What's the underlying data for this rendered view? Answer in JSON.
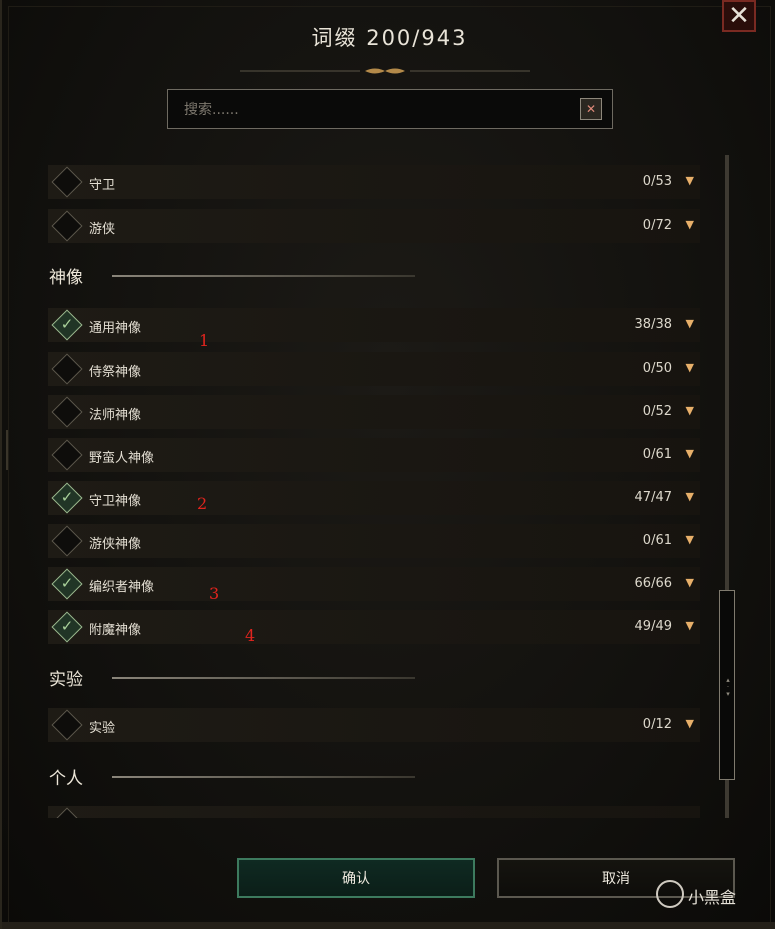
{
  "dialog": {
    "title": "词缀 200/943",
    "close_label": "✕"
  },
  "search": {
    "placeholder": "搜索......",
    "value": "",
    "clear_label": "✕"
  },
  "sections": {
    "idols_title": "神像",
    "experimental_title": "实验",
    "personal_title": "个人"
  },
  "rows": [
    {
      "label": "守卫",
      "count": "0/53",
      "checked": false
    },
    {
      "label": "游侠",
      "count": "0/72",
      "checked": false
    },
    {
      "label": "通用神像",
      "count": "38/38",
      "checked": true
    },
    {
      "label": "侍祭神像",
      "count": "0/50",
      "checked": false
    },
    {
      "label": "法师神像",
      "count": "0/52",
      "checked": false
    },
    {
      "label": "野蛮人神像",
      "count": "0/61",
      "checked": false
    },
    {
      "label": "守卫神像",
      "count": "47/47",
      "checked": true
    },
    {
      "label": "游侠神像",
      "count": "0/61",
      "checked": false
    },
    {
      "label": "编织者神像",
      "count": "66/66",
      "checked": true
    },
    {
      "label": "附魔神像",
      "count": "49/49",
      "checked": true
    },
    {
      "label": "实验",
      "count": "0/12",
      "checked": false
    }
  ],
  "arrow_glyph": "▼",
  "check_glyph": "✓",
  "annotations": [
    "1",
    "2",
    "3",
    "4"
  ],
  "buttons": {
    "confirm": "确认",
    "cancel": "取消"
  },
  "watermark": "小黑盒",
  "colors": {
    "checked_accent": "#a9d19a",
    "arrow": "#e8b06a",
    "annotation": "#e0241e",
    "confirm_border": "#3d7a5e",
    "close_border": "#7a2a22"
  }
}
